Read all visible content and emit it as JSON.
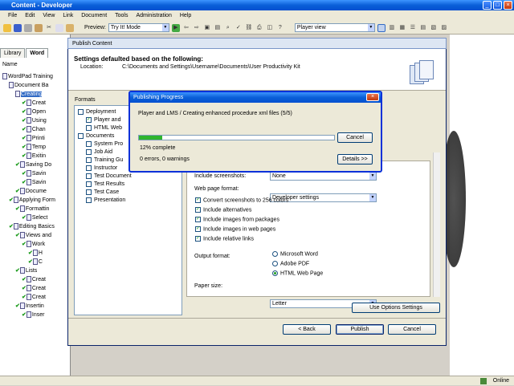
{
  "app": {
    "title": "Content - Developer"
  },
  "menu": [
    "File",
    "Edit",
    "View",
    "Link",
    "Document",
    "Tools",
    "Administration",
    "Help"
  ],
  "toolbar": {
    "preview_label": "Preview:",
    "preview_value": "Try It! Mode",
    "player_view": "Player view"
  },
  "tabs": [
    {
      "label": "Library"
    },
    {
      "label": "Word"
    }
  ],
  "tree_header": "Name",
  "tree": [
    {
      "label": "WordPad Training",
      "indent": 0,
      "chk": false
    },
    {
      "label": "Document Ba",
      "indent": 1,
      "chk": false
    },
    {
      "label": "Creating",
      "indent": 2,
      "chk": false
    },
    {
      "label": "Creat",
      "indent": 3,
      "chk": true
    },
    {
      "label": "Open",
      "indent": 3,
      "chk": true
    },
    {
      "label": "Using",
      "indent": 3,
      "chk": true
    },
    {
      "label": "Chan",
      "indent": 3,
      "chk": true
    },
    {
      "label": "Printi",
      "indent": 3,
      "chk": true
    },
    {
      "label": "Temp",
      "indent": 3,
      "chk": true
    },
    {
      "label": "Exitin",
      "indent": 3,
      "chk": true
    },
    {
      "label": "Saving Do",
      "indent": 2,
      "chk": true
    },
    {
      "label": "Savin",
      "indent": 3,
      "chk": true
    },
    {
      "label": "Savin",
      "indent": 3,
      "chk": true
    },
    {
      "label": "Docume",
      "indent": 2,
      "chk": true
    },
    {
      "label": "Applying Form",
      "indent": 1,
      "chk": true
    },
    {
      "label": "Formattin",
      "indent": 2,
      "chk": true
    },
    {
      "label": "Select",
      "indent": 3,
      "chk": true
    },
    {
      "label": "Editing Basics",
      "indent": 1,
      "chk": true
    },
    {
      "label": "Views and",
      "indent": 2,
      "chk": true
    },
    {
      "label": "Work",
      "indent": 3,
      "chk": true
    },
    {
      "label": "H",
      "indent": 4,
      "chk": true
    },
    {
      "label": "C",
      "indent": 4,
      "chk": true
    },
    {
      "label": "Lists",
      "indent": 2,
      "chk": true
    },
    {
      "label": "Creat",
      "indent": 3,
      "chk": true
    },
    {
      "label": "Creat",
      "indent": 3,
      "chk": true
    },
    {
      "label": "Creat",
      "indent": 3,
      "chk": true
    },
    {
      "label": "Insertin",
      "indent": 2,
      "chk": true
    },
    {
      "label": "Inser",
      "indent": 3,
      "chk": true
    }
  ],
  "dialog": {
    "title": "Publish Content",
    "heading": "Settings defaulted based on the following:",
    "location_label": "Location:",
    "location_value": "C:\\Documents and Settings\\Username\\Documents\\User Productivity Kit",
    "formats_label": "Formats",
    "formats": [
      {
        "label": "Deployment",
        "indent": 1,
        "check": false
      },
      {
        "label": "Player and",
        "indent": 2,
        "check": true
      },
      {
        "label": "HTML Web",
        "indent": 2,
        "check": false
      },
      {
        "label": "Documents",
        "indent": 1,
        "check": false
      },
      {
        "label": "System Pro",
        "indent": 2,
        "check": false
      },
      {
        "label": "Job Aid",
        "indent": 2,
        "check": false
      },
      {
        "label": "Training Gu",
        "indent": 2,
        "check": false
      },
      {
        "label": "Instructor",
        "indent": 2,
        "check": false
      },
      {
        "label": "Test Document",
        "indent": 2,
        "check": false
      },
      {
        "label": "Test Results",
        "indent": 2,
        "check": false
      },
      {
        "label": "Test Case",
        "indent": 2,
        "check": false
      },
      {
        "label": "Presentation",
        "indent": 2,
        "check": false
      }
    ],
    "include_screenshots_label": "Include screenshots:",
    "include_screenshots_value": "None",
    "web_format_label": "Web page format:",
    "web_format_value": "Developer settings",
    "checks": [
      "Convert screenshots to 256 colors",
      "Include alternatives",
      "Include images from packages",
      "Include images in web pages",
      "Include relative links"
    ],
    "output_label": "Output format:",
    "outputs": [
      {
        "label": "Microsoft Word",
        "on": false
      },
      {
        "label": "Adobe PDF",
        "on": false
      },
      {
        "label": "HTML Web Page",
        "on": true
      }
    ],
    "paper_label": "Paper size:",
    "paper_value": "Letter",
    "use_options": "Use Options Settings",
    "back": "< Back",
    "publish": "Publish",
    "cancel": "Cancel"
  },
  "progress": {
    "title": "Publishing Progress",
    "message": "Player and LMS / Creating enhanced procedure xml files (5/5)",
    "percent": 12,
    "percent_text": "12% complete",
    "errors": "0 errors, 0 warnings",
    "cancel": "Cancel",
    "details": "Details >>"
  },
  "status": {
    "online": "Online"
  }
}
